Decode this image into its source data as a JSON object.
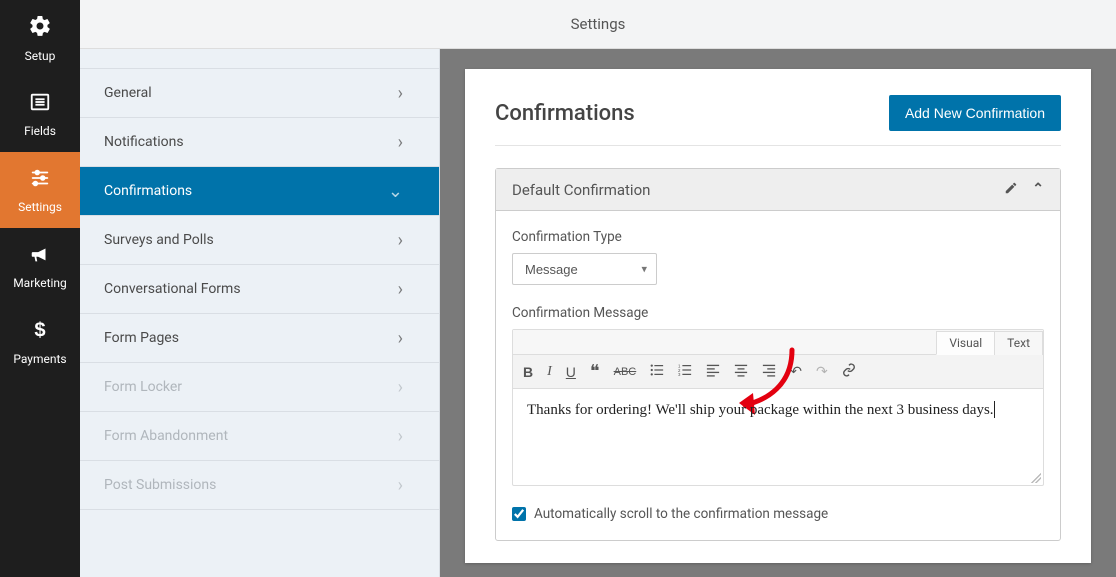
{
  "topbar": {
    "title": "Settings"
  },
  "sidebar": [
    {
      "label": "Setup",
      "id": "setup",
      "icon": "gear"
    },
    {
      "label": "Fields",
      "id": "fields",
      "icon": "list"
    },
    {
      "label": "Settings",
      "id": "settings",
      "icon": "sliders",
      "active": true
    },
    {
      "label": "Marketing",
      "id": "marketing",
      "icon": "bullhorn"
    },
    {
      "label": "Payments",
      "id": "payments",
      "icon": "dollar"
    }
  ],
  "submenu": [
    {
      "label": "General"
    },
    {
      "label": "Notifications"
    },
    {
      "label": "Confirmations",
      "active": true,
      "expanded": true
    },
    {
      "label": "Surveys and Polls"
    },
    {
      "label": "Conversational Forms"
    },
    {
      "label": "Form Pages"
    },
    {
      "label": "Form Locker",
      "disabled": true
    },
    {
      "label": "Form Abandonment",
      "disabled": true
    },
    {
      "label": "Post Submissions",
      "disabled": true
    }
  ],
  "panel": {
    "title": "Confirmations",
    "add_button": "Add New Confirmation",
    "card_title": "Default Confirmation",
    "type_label": "Confirmation Type",
    "type_value": "Message",
    "message_label": "Confirmation Message",
    "tabs": {
      "visual": "Visual",
      "text": "Text"
    },
    "message_value": "Thanks for ordering! We'll ship your package within the next 3 business days.",
    "autoscroll_label": "Automatically scroll to the confirmation message",
    "autoscroll_checked": true
  },
  "colors": {
    "primary": "#0073aa",
    "accent": "#e27730"
  }
}
